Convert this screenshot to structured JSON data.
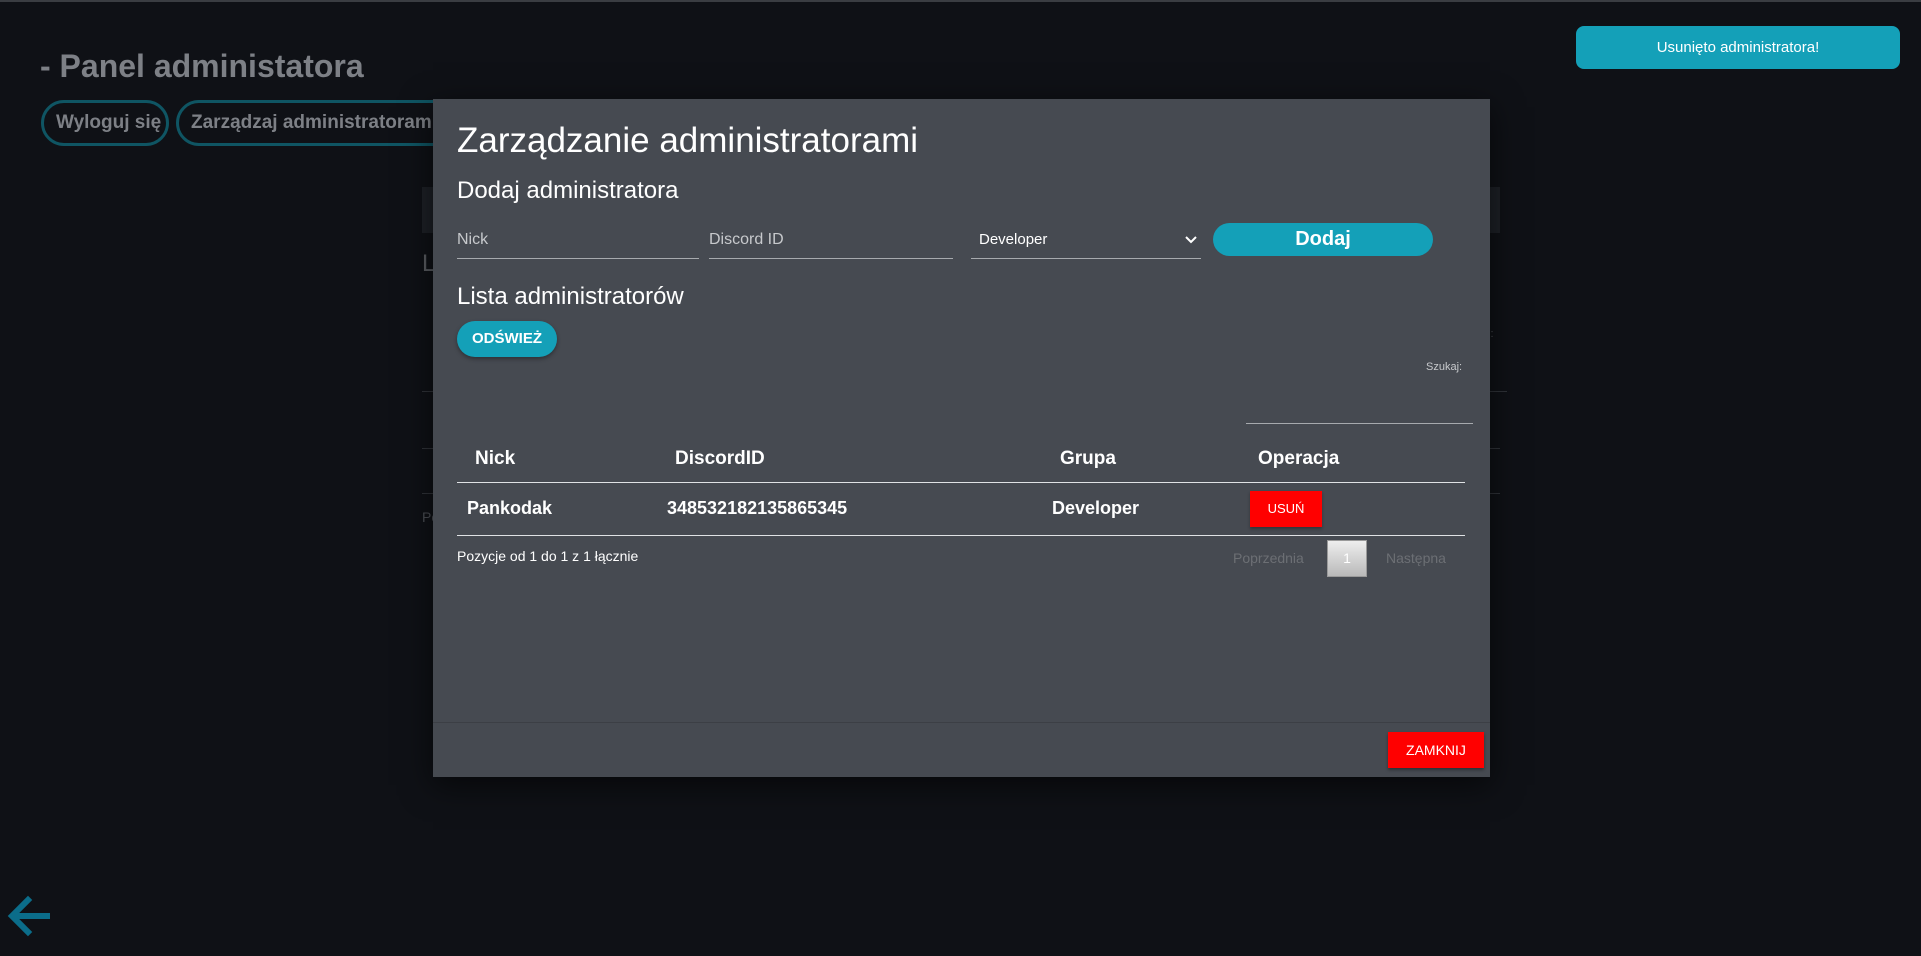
{
  "background": {
    "panel_title": "- Panel administatora",
    "logout_label": "Wyloguj się",
    "manage_label": "Zarządzaj administratorami",
    "fragment_letter": "L",
    "fragment_text": "Po",
    "fragment_search": "aj:"
  },
  "toast": {
    "message": "Usunięto administratora!"
  },
  "modal": {
    "title": "Zarządzanie administratorami",
    "add_section": {
      "title": "Dodaj administratora",
      "nick_placeholder": "Nick",
      "discord_placeholder": "Discord ID",
      "group_selected": "Developer",
      "add_label": "Dodaj"
    },
    "list_section": {
      "title": "Lista administratorów",
      "refresh_label": "ODŚWIEŻ",
      "search_label": "Szukaj:",
      "columns": [
        "Nick",
        "DiscordID",
        "Grupa",
        "Operacja"
      ],
      "rows": [
        {
          "nick": "Pankodak",
          "discord_id": "348532182135865345",
          "group": "Developer",
          "action": "USUŃ"
        }
      ],
      "info": "Pozycje od 1 do 1 z 1 łącznie",
      "pager": {
        "prev": "Poprzednia",
        "page": "1",
        "next": "Następna"
      }
    },
    "close_label": "ZAMKNIJ"
  },
  "colors": {
    "accent": "#14a0b8",
    "danger": "#ff0000",
    "modal_bg": "#464a51",
    "page_bg": "#0f1116"
  },
  "icons": {
    "back": "arrow-left-icon",
    "select": "chevron-down-icon"
  }
}
